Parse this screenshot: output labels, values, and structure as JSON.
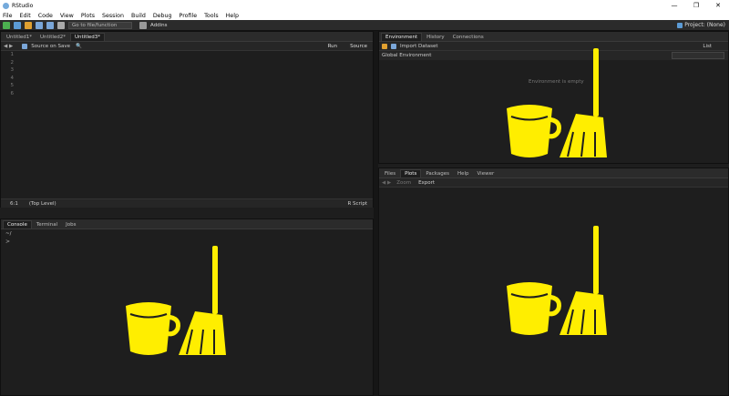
{
  "window": {
    "title": "RStudio"
  },
  "menu": [
    "File",
    "Edit",
    "Code",
    "View",
    "Plots",
    "Session",
    "Build",
    "Debug",
    "Profile",
    "Tools",
    "Help"
  ],
  "toolbar": {
    "goto_placeholder": "Go to file/function",
    "addins": "Addins",
    "project": "Project: (None)"
  },
  "editor": {
    "tabs": [
      "Untitled1*",
      "Untitled2*",
      "Untitled3*"
    ],
    "source_on_save": "Source on Save",
    "run": "Run",
    "source": "Source",
    "line_numbers": [
      "1",
      "2",
      "3",
      "4",
      "5",
      "6"
    ],
    "status_pos": "6:1",
    "status_scope": "(Top Level)",
    "status_type": "R Script"
  },
  "console": {
    "tabs": [
      "Console",
      "Terminal",
      "Jobs"
    ],
    "path": "~/",
    "prompt": ">"
  },
  "environment": {
    "tabs": [
      "Environment",
      "History",
      "Connections"
    ],
    "import": "Import Dataset",
    "list": "List",
    "scope": "Global Environment",
    "empty_msg": "Environment is empty"
  },
  "files": {
    "tabs": [
      "Files",
      "Plots",
      "Packages",
      "Help",
      "Viewer"
    ],
    "zoom": "Zoom",
    "export": "Export"
  },
  "colors": {
    "accent_yellow": "#ffee00",
    "bg": "#1e1e1e"
  }
}
